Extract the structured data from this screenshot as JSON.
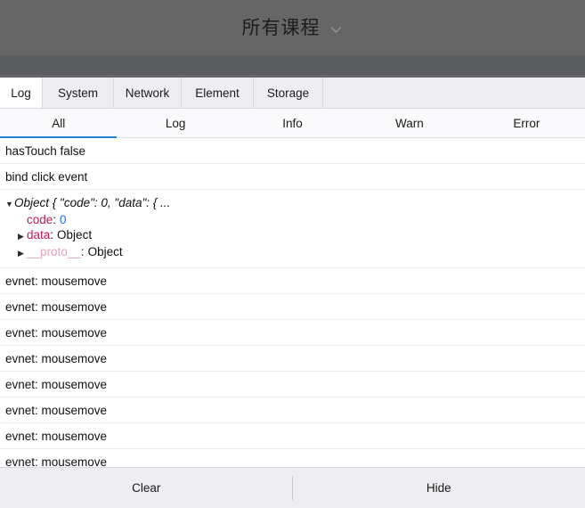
{
  "page_header": {
    "title": "所有课程",
    "dropdown_icon": "chevron-down-icon",
    "background_color": "#666666",
    "subbar_color": "#5c5d60"
  },
  "devtools": {
    "primary_tabs": [
      {
        "label": "Log",
        "active": true
      },
      {
        "label": "System",
        "active": false
      },
      {
        "label": "Network",
        "active": false
      },
      {
        "label": "Element",
        "active": false
      },
      {
        "label": "Storage",
        "active": false
      }
    ],
    "filter_tabs": [
      {
        "label": "All",
        "active": true
      },
      {
        "label": "Log",
        "active": false
      },
      {
        "label": "Info",
        "active": false
      },
      {
        "label": "Warn",
        "active": false
      },
      {
        "label": "Error",
        "active": false
      }
    ],
    "active_tab_underline_color": "#2082df",
    "log_entries": [
      {
        "type": "text",
        "text": "hasTouch false"
      },
      {
        "type": "text",
        "text": "bind click event"
      },
      {
        "type": "object",
        "expand_icon": "triangle-down-icon",
        "summary": "Object { \"code\": 0, \"data\": { ...",
        "properties": [
          {
            "expand_icon": "",
            "key": "code",
            "separator": ":",
            "value": "0",
            "value_type": "number"
          },
          {
            "expand_icon": "triangle-right-icon",
            "key": "data",
            "separator": ":",
            "value": "Object",
            "value_type": "object"
          },
          {
            "expand_icon": "triangle-right-icon",
            "key": "__proto__",
            "separator": ":",
            "value": "Object",
            "value_type": "object",
            "key_style": "proto"
          }
        ]
      },
      {
        "type": "text",
        "text": "evnet: mousemove"
      },
      {
        "type": "text",
        "text": "evnet: mousemove"
      },
      {
        "type": "text",
        "text": "evnet: mousemove"
      },
      {
        "type": "text",
        "text": "evnet: mousemove"
      },
      {
        "type": "text",
        "text": "evnet: mousemove"
      },
      {
        "type": "text",
        "text": "evnet: mousemove"
      },
      {
        "type": "text",
        "text": "evnet: mousemove"
      },
      {
        "type": "text",
        "text": "evnet: mousemove"
      }
    ],
    "bottom_bar": {
      "clear_label": "Clear",
      "hide_label": "Hide"
    }
  }
}
